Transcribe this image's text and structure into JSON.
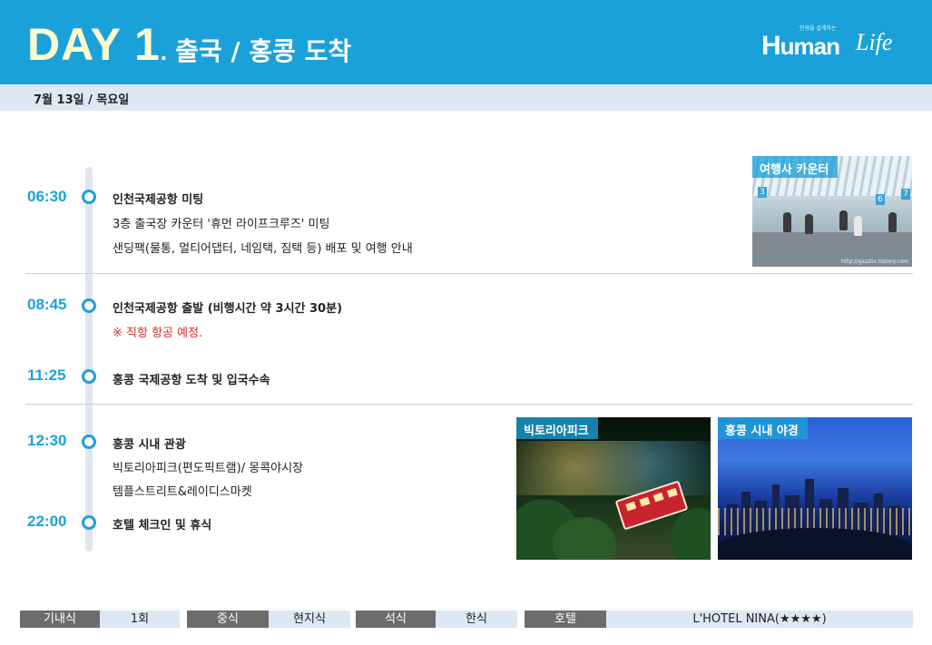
{
  "header": {
    "day_label": "DAY 1",
    "day_dot": ".",
    "title": "출국 / 홍콩 도착",
    "logo": {
      "tagline": "인생을 설계하는",
      "mark": "uman",
      "mark_initial": "H",
      "script": "Life"
    }
  },
  "date": "7월 13일 / 목요일",
  "schedule": [
    {
      "time": "06:30",
      "title": "인천국제공항 미팅",
      "lines": [
        "3층 출국장 카운터 '휴먼 라이프크루즈' 미팅",
        "샌딩팩(물통, 멀티어댑터, 네임택, 짐택 등) 배포 및 여행 안내"
      ]
    },
    {
      "time": "08:45",
      "title": "인천국제공항 출발 (비행시간 약 3시간 30분)",
      "note": "※ 직항 항공 예정."
    },
    {
      "time": "11:25",
      "title": "홍콩 국제공항 도착 및 입국수속"
    },
    {
      "time": "12:30",
      "title": "홍콩 시내 관광",
      "lines": [
        "빅토리아피크(편도픽트램)/ 몽콕야시장",
        "템플스트리트&레이디스마켓"
      ]
    },
    {
      "time": "22:00",
      "title": "호텔 체크인 및 휴식"
    }
  ],
  "photos": {
    "counter": {
      "caption": "여행사 카운터",
      "watermark": "http://gazzlix.tistory.com"
    },
    "victoria": {
      "caption": "빅토리아피크"
    },
    "night": {
      "caption": "홍콩 시내 야경"
    }
  },
  "footer": {
    "items": [
      {
        "label": "기내식",
        "value": "1회"
      },
      {
        "label": "중식",
        "value": "현지식"
      },
      {
        "label": "석식",
        "value": "한식"
      },
      {
        "label": "호텔",
        "value": "L'HOTEL NINA(★★★★)"
      }
    ]
  },
  "colors": {
    "accent": "#1ba1d9",
    "date_bar": "#dde8f4",
    "note_red": "#d7312b",
    "label_gray": "#6c6c6c"
  }
}
